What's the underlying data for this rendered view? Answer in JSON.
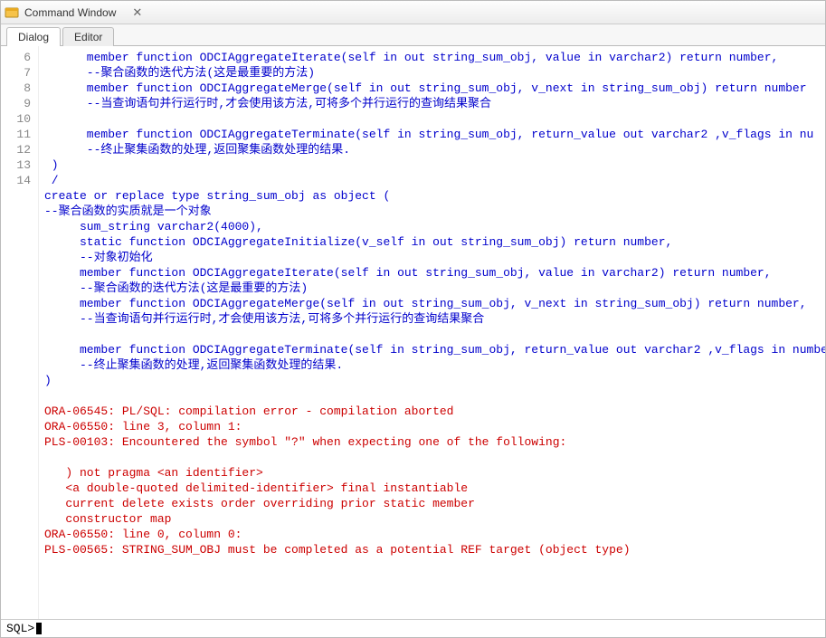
{
  "window": {
    "title": "Command Window"
  },
  "tabs": {
    "dialog": "Dialog",
    "editor": "Editor",
    "active": "dialog"
  },
  "gutter_lines": [
    "6",
    "7",
    "8",
    "9",
    "10",
    "11",
    "12",
    "13",
    "14"
  ],
  "code": {
    "l6": "      member function ODCIAggregateIterate(self in out string_sum_obj, value in varchar2) return number,",
    "l7": "      --聚合函数的迭代方法(这是最重要的方法)",
    "l8": "      member function ODCIAggregateMerge(self in out string_sum_obj, v_next in string_sum_obj) return number",
    "l9": "      --当查询语句并行运行时,才会使用该方法,可将多个并行运行的查询结果聚合",
    "l10": "",
    "l11": "      member function ODCIAggregateTerminate(self in string_sum_obj, return_value out varchar2 ,v_flags in nu",
    "l12": "      --终止聚集函数的处理,返回聚集函数处理的结果.",
    "l13": " )",
    "l14": " /",
    "b1": "create or replace type string_sum_obj as object (",
    "b2": "--聚合函数的实质就是一个对象",
    "b3": "     sum_string varchar2(4000),",
    "b4": "     static function ODCIAggregateInitialize(v_self in out string_sum_obj) return number,",
    "b5": "     --对象初始化",
    "b6": "     member function ODCIAggregateIterate(self in out string_sum_obj, value in varchar2) return number,",
    "b7": "     --聚合函数的迭代方法(这是最重要的方法)",
    "b8": "     member function ODCIAggregateMerge(self in out string_sum_obj, v_next in string_sum_obj) return number,",
    "b9": "     --当查询语句并行运行时,才会使用该方法,可将多个并行运行的查询结果聚合",
    "b10": "",
    "b11": "     member function ODCIAggregateTerminate(self in string_sum_obj, return_value out varchar2 ,v_flags in number",
    "b12": "     --终止聚集函数的处理,返回聚集函数处理的结果.",
    "b13": ")",
    "b14": ""
  },
  "errors": {
    "e1": "ORA-06545: PL/SQL: compilation error - compilation aborted",
    "e2": "ORA-06550: line 3, column 1:",
    "e3": "PLS-00103: Encountered the symbol \"?\" when expecting one of the following:",
    "e4": "",
    "e5": "   ) not pragma <an identifier>",
    "e6": "   <a double-quoted delimited-identifier> final instantiable",
    "e7": "   current delete exists order overriding prior static member",
    "e8": "   constructor map",
    "e9": "ORA-06550: line 0, column 0:",
    "e10": "PLS-00565: STRING_SUM_OBJ must be completed as a potential REF target (object type)"
  },
  "prompt": "SQL>",
  "icons": {
    "app": "command-window-icon",
    "close": "✕"
  },
  "colors": {
    "keyword": "#0000cc",
    "error": "#cc0000"
  }
}
